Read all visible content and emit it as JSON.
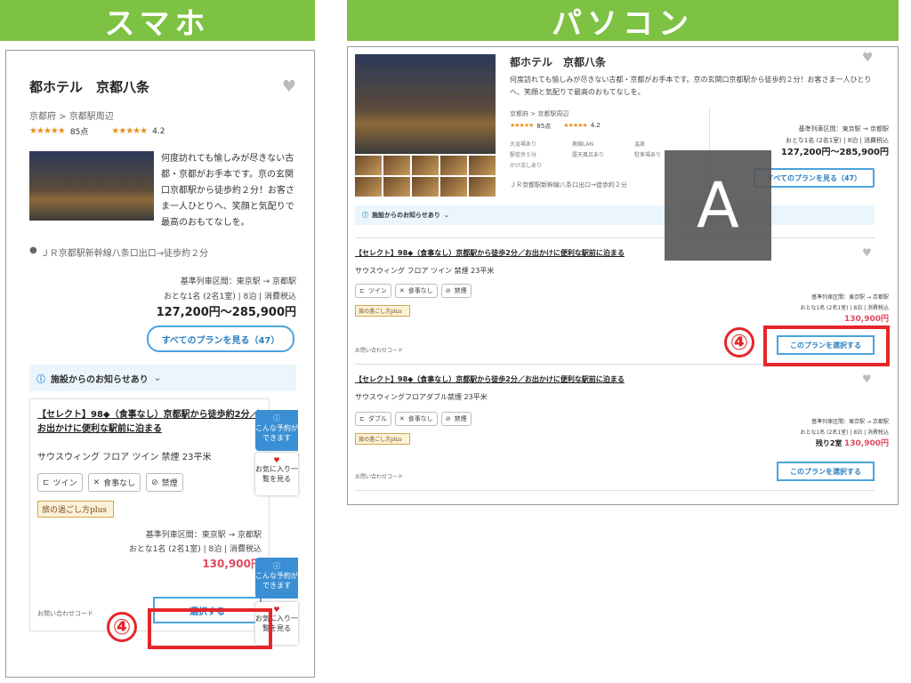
{
  "headers": {
    "smartphone": "スマホ",
    "pc": "パソコン"
  },
  "hotel": {
    "name": "都ホテル　京都八条",
    "breadcrumb": "京都府 > 京都駅周辺",
    "rating_stars": "★★★★★",
    "rating_score": "85点",
    "review_stars": "★★★★★",
    "review_score": "4.2",
    "description_sp": "何度訪れても愉しみが尽きない古都・京都がお手本です。京の玄関口京都駅から徒歩約２分！お客さま一人ひとりへ、笑顔と気配りで最高のおもてなしを。",
    "description_pc": "何度訪れても愉しみが尽きない古都・京都がお手本です。京の玄関口京都駅から徒歩約２分！お客さま一人ひとりへ、笑顔と気配りで最高のおもてなしを。",
    "access": "ＪＲ京都駅新幹線八条口出口→徒歩約２分",
    "transport_line": "基準列車区間：東京駅 → 京都駅",
    "guests_line": "おとな1名 (2名1室) | 8泊 | 消費税込",
    "price_range": "127,200円〜285,900円",
    "all_plans_button": "すべてのプランを見る（47）",
    "notice": "施設からのお知らせあり",
    "amenities": [
      "大浴場あり",
      "無線LAN",
      "温泉",
      "駅徒歩５分",
      "露天風呂あり",
      "駐車場あり",
      "かけ流しあり"
    ]
  },
  "sp": {
    "plan_title": "【セレクト】98◆（食事なし）京都駅から徒歩約2分／お出かけに便利な駅前に泊まる",
    "room": "サウスウィング フロア ツイン 禁煙 23平米",
    "chips": [
      "ツイン",
      "食事なし",
      "禁煙"
    ],
    "badge": "旅の過ごし方plus",
    "transport_line": "基準列車区間：東京駅 → 京都駅",
    "guests_line": "おとな1名 (2名1室) | 8泊 | 消費税込",
    "price": "130,900円",
    "contact": "お問い合わせコード",
    "select_button": "選択する",
    "widget_plan": "こんな予約ができます",
    "widget_fav": "お気に入り一覧を見る"
  },
  "pc": {
    "overlay_letter": "A",
    "plans": [
      {
        "title": "【セレクト】98◆（食事なし）京都駅から徒歩2分／お出かけに便利な駅前に泊まる",
        "room": "サウスウィング フロア ツイン 禁煙 23平米",
        "chips": [
          "ツイン",
          "食事なし",
          "禁煙"
        ],
        "price": "130,900円",
        "rooms_left": "",
        "button": "このプランを選択する"
      },
      {
        "title": "【セレクト】98◆（食事なし）京都駅から徒歩2分／お出かけに便利な駅前に泊まる",
        "room": "サウスウィングフロアダブル禁煙 23平米",
        "chips": [
          "ダブル",
          "食事なし",
          "禁煙"
        ],
        "price": "130,900円",
        "rooms_left": "残り2室",
        "button": "このプランを選択する"
      }
    ]
  },
  "step_marker": "④",
  "colors": {
    "green": "#7dc242",
    "red": "#e5262a",
    "blue": "#4aa3df",
    "price_red": "#e04a5f"
  }
}
